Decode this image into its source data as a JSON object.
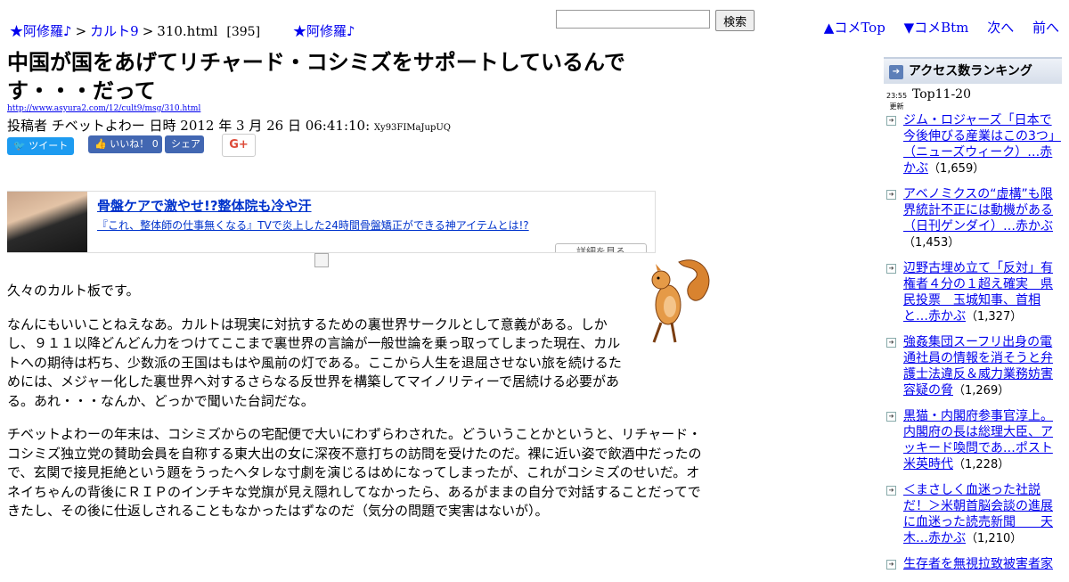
{
  "nav": {
    "site_link": "★阿修羅♪",
    "separator": ">",
    "board_link": "カルト9",
    "page_name": "310.html",
    "count": "[395]",
    "site_link2": "★阿修羅♪"
  },
  "search": {
    "value": "",
    "button": "検索"
  },
  "top_links": {
    "comment_top": "▲コメTop",
    "comment_bottom": "▼コメBtm",
    "next": "次へ",
    "prev": "前へ"
  },
  "post": {
    "title": "中国が国をあげてリチャード・コシミズをサポートしているんです・・・だって",
    "url": "http://www.asyura2.com/12/cult9/msg/310.html",
    "meta": "投稿者 チベットよわー 日時 2012 年 3 月 26 日 06:41:10:",
    "uid": "Xy93FIMaJupUQ"
  },
  "social": {
    "tweet": "ツイート",
    "like": "いいね！ 0",
    "share": "シェア",
    "gplus": "G+"
  },
  "ad": {
    "headline": "骨盤ケアで激やせ!?整体院も冷や汗",
    "description": "『これ、整体師の仕事無くなる』TVで炎上した24時間骨盤矯正ができる神アイテムとは!?",
    "more": "詳細を見る"
  },
  "body": {
    "p1": "久々のカルト板です。",
    "p2": "なんにもいいことねえなあ。カルトは現実に対抗するための裏世界サークルとして意義がある。しかし、９１１以降どんどん力をつけてここまで裏世界の言論が一般世論を乗っ取ってしまった現在、カルトへの期待は朽ち、少数派の王国はもはや風前の灯である。ここから人生を退屈させない旅を続けるためには、メジャー化した裏世界へ対するさらなる反世界を構築してマイノリティーで居続ける必要がある。あれ・・・なんか、どっかで聞いた台詞だな。",
    "p3": "チベットよわーの年末は、コシミズからの宅配便で大いにわずらわされた。どういうことかというと、リチャード・コシミズ独立党の賛助会員を自称する東大出の女に深夜不意打ちの訪問を受けたのだ。裸に近い姿で飲酒中だったので、玄関で接見拒絶という題をうったヘタレな寸劇を演じるはめになってしまったが、これがコシミズのせいだ。オネイちゃんの背後にＲＩＰのインチキな党旗が見え隠れしてなかったら、あるがままの自分で対話することだってできたし、その後に仕返しされることもなかったはずなのだ（気分の問題で実害はないが）。"
  },
  "ranking": {
    "header": "アクセス数ランキング",
    "time": "23:55",
    "updated": "更新",
    "range": "Top11-20",
    "items": [
      {
        "title": "ジム・ロジャーズ「日本で今後伸びる産業はこの3つ」（ニューズウィーク）…赤かぶ",
        "count": "（1,659）"
      },
      {
        "title": "アベノミクスの“虚構”も限界統計不正には動機がある（日刊ゲンダイ）…赤かぶ",
        "count": "（1,453）"
      },
      {
        "title": "辺野古埋め立て「反対」有権者４分の１超え確実　県民投票　玉城知事、首相と…赤かぶ",
        "count": "（1,327）"
      },
      {
        "title": "強姦集団スーフリ出身の電通社員の情報を消そうと弁護士法違反＆威力業務妨害容疑の脅",
        "count": "（1,269）"
      },
      {
        "title": "黒猫・内閣府参事官淳上。内閣府の長は総理大臣、アッキード喚問であ…ポスト米英時代",
        "count": "（1,228）"
      },
      {
        "title": "＜まさしく血迷った社説だ！＞米朝首脳会談の進展に血迷った読売新聞　　天木…赤かぶ",
        "count": "（1,210）"
      },
      {
        "title": "生存者を無視拉致被害者家",
        "count": ""
      }
    ]
  }
}
